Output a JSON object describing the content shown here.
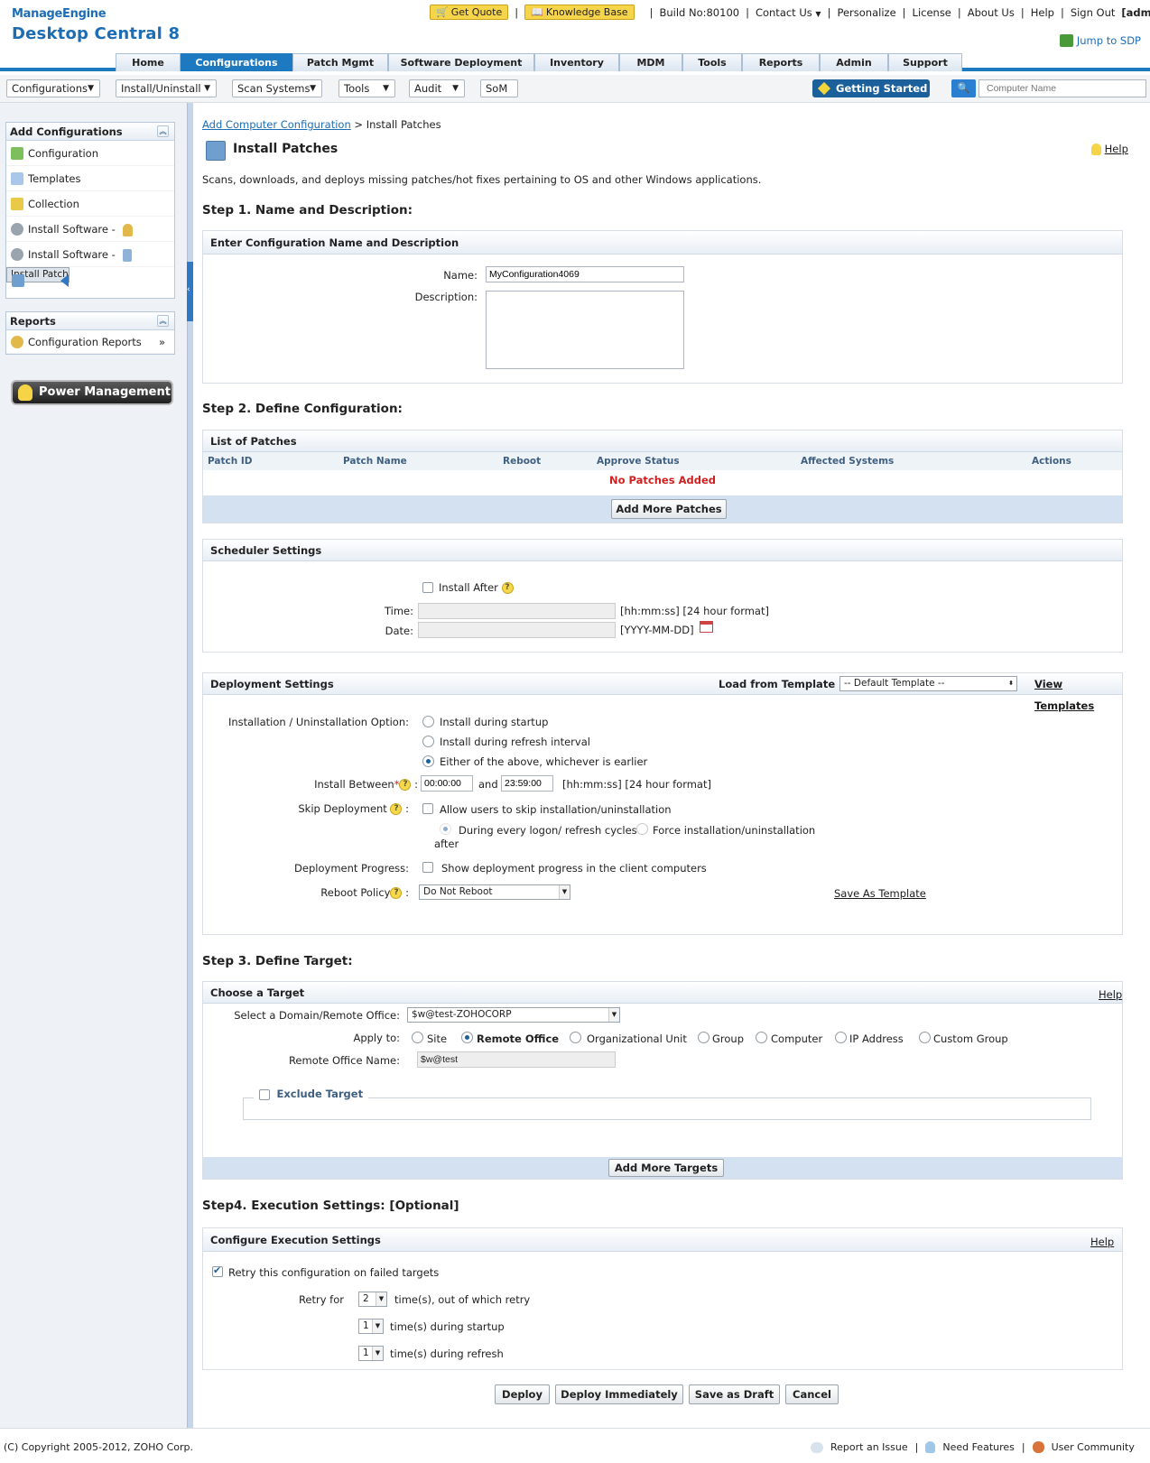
{
  "header": {
    "brand_top": "ManageEngine",
    "brand_product": "Desktop Central 8",
    "get_quote": "Get Quote",
    "knowledge_base": "Knowledge Base",
    "build": "Build No:80100",
    "contact_us": "Contact Us",
    "personalize": "Personalize",
    "license": "License",
    "about_us": "About Us",
    "help": "Help",
    "sign_out": "Sign Out",
    "user": "[admin]",
    "jump_sdp": "Jump to SDP"
  },
  "tabs": [
    {
      "label": "Home"
    },
    {
      "label": "Configurations"
    },
    {
      "label": "Patch Mgmt"
    },
    {
      "label": "Software Deployment"
    },
    {
      "label": "Inventory"
    },
    {
      "label": "MDM"
    },
    {
      "label": "Tools"
    },
    {
      "label": "Reports"
    },
    {
      "label": "Admin"
    },
    {
      "label": "Support"
    }
  ],
  "subnav": [
    {
      "label": "Configurations"
    },
    {
      "label": "Install/Uninstall"
    },
    {
      "label": "Scan Systems"
    },
    {
      "label": "Tools"
    },
    {
      "label": "Audit"
    },
    {
      "label": "SoM"
    }
  ],
  "getting_started": "Getting Started",
  "search": {
    "placeholder": "Computer Name"
  },
  "sidebar": {
    "add_title": "Add Configurations",
    "add_items": [
      {
        "label": "Configuration"
      },
      {
        "label": "Templates"
      },
      {
        "label": "Collection"
      },
      {
        "label": "Install Software -"
      },
      {
        "label": "Install Software -"
      },
      {
        "label": "Install Patch"
      }
    ],
    "reports_title": "Reports",
    "reports_items": [
      {
        "label": "Configuration Reports"
      }
    ],
    "power": "Power Management"
  },
  "breadcrumb": {
    "link": "Add Computer Configuration",
    "sep": ">",
    "current": "Install Patches"
  },
  "page": {
    "title": "Install Patches",
    "help": "Help",
    "desc": "Scans, downloads, and deploys missing patches/hot fixes pertaining to OS and other Windows applications."
  },
  "step1": {
    "title": "Step 1. Name and Description:",
    "section": "Enter Configuration Name and Description",
    "name_label": "Name:",
    "name_value": "MyConfiguration4069",
    "desc_label": "Description:"
  },
  "step2": {
    "title": "Step 2. Define Configuration:",
    "patches_title": "List of Patches",
    "columns": [
      "Patch ID",
      "Patch Name",
      "Reboot",
      "Approve Status",
      "Affected Systems",
      "Actions"
    ],
    "empty": "No Patches Added",
    "add_more": "Add More Patches",
    "sched_title": "Scheduler Settings",
    "install_after": "Install After",
    "time_label": "Time:",
    "time_hint": "[hh:mm:ss] [24 hour format]",
    "date_label": "Date:",
    "date_hint": "[YYYY-MM-DD]",
    "deploy_title": "Deployment Settings",
    "load_template": "Load from Template",
    "template_value": "-- Default Template --",
    "view_templates": "View Templates",
    "install_option_label": "Installation / Uninstallation Option:",
    "opt_startup": "Install during startup",
    "opt_refresh": "Install during refresh interval",
    "opt_either": "Either of the above, whichever is earlier",
    "install_between": "Install Between",
    "from": "00:00:00",
    "and": "and",
    "to": "23:59:00",
    "between_hint": "[hh:mm:ss] [24 hour format]",
    "skip_label": "Skip Deployment",
    "skip_allow": "Allow users to skip installation/uninstallation",
    "skip_every": "During every logon/ refresh cycles",
    "skip_force": "Force installation/uninstallation",
    "after": "after",
    "progress_label": "Deployment Progress:",
    "progress_text": "Show deployment progress in the client computers",
    "reboot_label": "Reboot Policy",
    "reboot_value": "Do Not Reboot",
    "save_template": "Save As Template"
  },
  "step3": {
    "title": "Step 3. Define Target:",
    "section": "Choose a Target",
    "help": "Help",
    "domain_label": "Select a Domain/Remote Office:",
    "domain_value": "$w@test-ZOHOCORP",
    "apply_label": "Apply to:",
    "apply_options": [
      "Site",
      "Remote Office",
      "Organizational Unit",
      "Group",
      "Computer",
      "IP Address",
      "Custom Group"
    ],
    "ro_label": "Remote Office Name:",
    "ro_value": "$w@test",
    "exclude": "Exclude Target",
    "add_more": "Add More Targets"
  },
  "step4": {
    "title": "Step4. Execution Settings: [Optional]",
    "section": "Configure Execution Settings",
    "help": "Help",
    "retry_check": "Retry this configuration on failed targets",
    "retry_for": "Retry for",
    "retry_value": "2",
    "retry_suffix": "time(s), out of which retry",
    "startup_value": "1",
    "startup_suffix": "time(s) during startup",
    "refresh_value": "1",
    "refresh_suffix": "time(s) during refresh"
  },
  "actions": {
    "deploy": "Deploy",
    "deploy_now": "Deploy Immediately",
    "draft": "Save as Draft",
    "cancel": "Cancel"
  },
  "footer": {
    "copyright": "(C) Copyright 2005-2012, ZOHO Corp.",
    "report_issue": "Report an Issue",
    "need_features": "Need Features",
    "community": "User Community"
  }
}
